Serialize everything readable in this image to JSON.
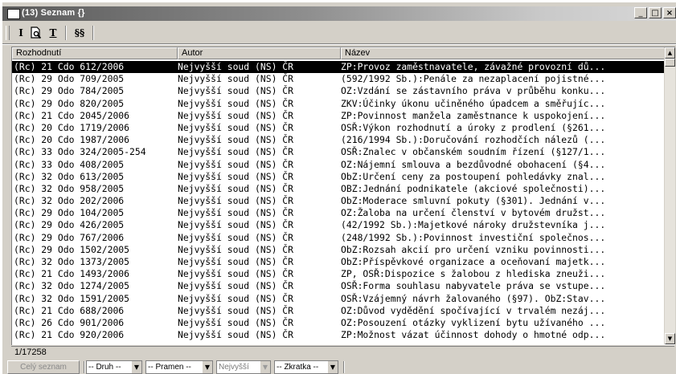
{
  "window": {
    "title": "(13) Seznam {}",
    "buttons": {
      "minimize": "_",
      "maximize": "□",
      "close": "×"
    }
  },
  "toolbar": {
    "tools": [
      {
        "label": "I",
        "name": "info-tool"
      },
      {
        "label": "",
        "name": "search-document-icon"
      },
      {
        "label": "T",
        "name": "text-tool"
      },
      {
        "label": "§§",
        "name": "paragraphs-tool"
      }
    ]
  },
  "list": {
    "columns": [
      "Rozhodnutí",
      "Autor",
      "Název"
    ],
    "rows": [
      [
        "(Rc) 21 Cdo 612/2006",
        "Nejvyšší soud (NS) ČR",
        "ZP:Provoz zaměstnavatele, závažné provozní dů..."
      ],
      [
        "(Rc) 29 Odo 709/2005",
        "Nejvyšší soud (NS) ČR",
        "(592/1992 Sb.):Penále za nezaplacení pojistné..."
      ],
      [
        "(Rc) 29 Odo 784/2005",
        "Nejvyšší soud (NS) ČR",
        "OZ:Vzdání se zástavního práva v průběhu konku..."
      ],
      [
        "(Rc) 29 Odo 820/2005",
        "Nejvyšší soud (NS) ČR",
        "ZKV:Účinky úkonu učiněného úpadcem a směřujíc..."
      ],
      [
        "(Rc) 21 Cdo 2045/2006",
        "Nejvyšší soud (NS) ČR",
        "ZP:Povinnost manžela zaměstnance k uspokojení..."
      ],
      [
        "(Rc) 20 Cdo 1719/2006",
        "Nejvyšší soud (NS) ČR",
        "OSŘ:Výkon rozhodnutí a úroky z prodlení (§261..."
      ],
      [
        "(Rc) 20 Cdo 1987/2006",
        "Nejvyšší soud (NS) ČR",
        "(216/1994 Sb.):Doručování rozhodčích nálezů (..."
      ],
      [
        "(Rc) 33 Odo 324/2005-254",
        "Nejvyšší soud (NS) ČR",
        "OSŘ:Znalec v občanském soudním řízení (§127/1..."
      ],
      [
        "(Rc) 33 Odo 408/2005",
        "Nejvyšší soud (NS) ČR",
        "OZ:Nájemní smlouva a bezdůvodné obohacení (§4..."
      ],
      [
        "(Rc) 32 Odo 613/2005",
        "Nejvyšší soud (NS) ČR",
        "ObZ:Určení ceny za postoupení pohledávky znal..."
      ],
      [
        "(Rc) 32 Odo 958/2005",
        "Nejvyšší soud (NS) ČR",
        "OBZ:Jednání podnikatele (akciové společnosti)..."
      ],
      [
        "(Rc) 32 Odo 202/2006",
        "Nejvyšší soud (NS) ČR",
        "ObZ:Moderace smluvní pokuty (§301). Jednání v..."
      ],
      [
        "(Rc) 29 Odo 104/2005",
        "Nejvyšší soud (NS) ČR",
        "OZ:Žaloba na určení členství v bytovém družst..."
      ],
      [
        "(Rc) 29 Odo 426/2005",
        "Nejvyšší soud (NS) ČR",
        "(42/1992 Sb.):Majetkové nároky družstevníka j..."
      ],
      [
        "(Rc) 29 Odo 767/2006",
        "Nejvyšší soud (NS) ČR",
        "(248/1992 Sb.):Povinnost investiční společnos..."
      ],
      [
        "(Rc) 29 Odo 1502/2005",
        "Nejvyšší soud (NS) ČR",
        "ObZ:Rozsah akcií pro určení vzniku povinnosti..."
      ],
      [
        "(Rc) 32 Odo 1373/2005",
        "Nejvyšší soud (NS) ČR",
        "ObZ:Příspěvkové organizace a oceňovaní majetk..."
      ],
      [
        "(Rc) 21 Cdo 1493/2006",
        "Nejvyšší soud (NS) ČR",
        "ZP, OSŘ:Dispozice s žalobou z hlediska zneuži..."
      ],
      [
        "(Rc) 32 Odo 1274/2005",
        "Nejvyšší soud (NS) ČR",
        "OSŘ:Forma souhlasu nabyvatele práva se vstupe..."
      ],
      [
        "(Rc) 32 Odo 1591/2005",
        "Nejvyšší soud (NS) ČR",
        "OSŘ:Vzájemný návrh žalovaného (§97). ObZ:Stav..."
      ],
      [
        "(Rc) 21 Cdo 688/2006",
        "Nejvyšší soud (NS) ČR",
        "OZ:Důvod vydědění spočívající v trvalém nezáj..."
      ],
      [
        "(Rc) 26 Cdo 901/2006",
        "Nejvyšší soud (NS) ČR",
        "OZ:Posouzení otázky vyklizení bytu užívaného ..."
      ],
      [
        "(Rc) 21 Cdo 920/2006",
        "Nejvyšší soud (NS) ČR",
        "ZP:Možnost vázat účinnost dohody o hmotné odp..."
      ]
    ]
  },
  "status": {
    "count": "1/17258"
  },
  "filters": {
    "all_button": "Celý seznam",
    "druh": "-- Druh --",
    "pramen": "-- Pramen --",
    "author": "Nejvyšší",
    "zkratka": "-- Zkratka --"
  }
}
